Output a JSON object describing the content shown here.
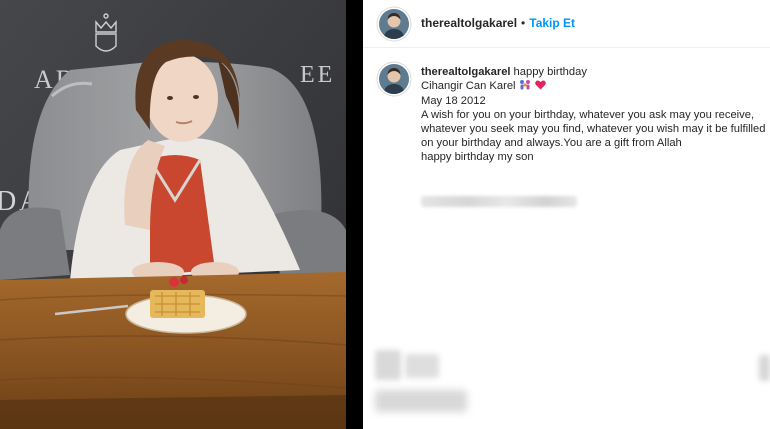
{
  "post": {
    "username": "therealtolgakarel",
    "follow_label": "Takip Et",
    "separator": "•",
    "caption_first": "happy birthday",
    "caption_lines": [
      "Cihangir Can Karel",
      "May 18 2012",
      "A wish for you on your birthday, whatever you ask may you receive, whatever you seek may you find, whatever you wish may it be fulfilled on your birthday and always.You are a gift from Allah",
      "happy birthday my son"
    ]
  },
  "photo": {
    "sign_text_left": "ADRA",
    "sign_text_right": "EE",
    "sign_text_lower": "DAM"
  },
  "icons": {
    "avatar": "profile-avatar-icon",
    "emoji_1": "family-emoji-icon",
    "emoji_2": "red-heart-icon",
    "sign_logo": "crown-shield-logo-icon"
  },
  "colors": {
    "follow_blue": "#0095f6",
    "heart_red": "#e0245e",
    "text": "#262626",
    "divider": "#000000"
  }
}
